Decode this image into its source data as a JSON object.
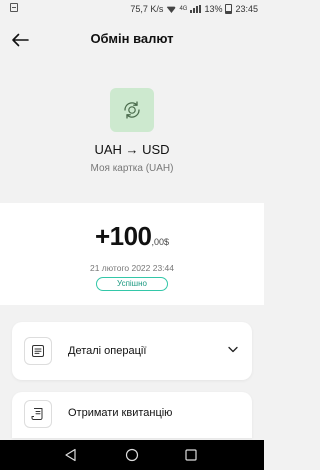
{
  "status_bar": {
    "speed": "75,7 K/s",
    "battery": "13%",
    "time": "23:45",
    "network_tag": "4G"
  },
  "header": {
    "title": "Обмін валют"
  },
  "transaction": {
    "pair": "UAH → USD",
    "card": "Моя картка (UAH)",
    "amount_main": "+100",
    "amount_fraction": ",00",
    "amount_currency": "$",
    "datetime": "21 лютого 2022 23:44",
    "status": "Успішно"
  },
  "actions": {
    "details_label": "Деталі операції",
    "receipt_label": "Отримати квитанцію"
  },
  "colors": {
    "accent": "#33c7a8",
    "icon_bg": "#cde9cf",
    "background": "#f2f2f2"
  }
}
